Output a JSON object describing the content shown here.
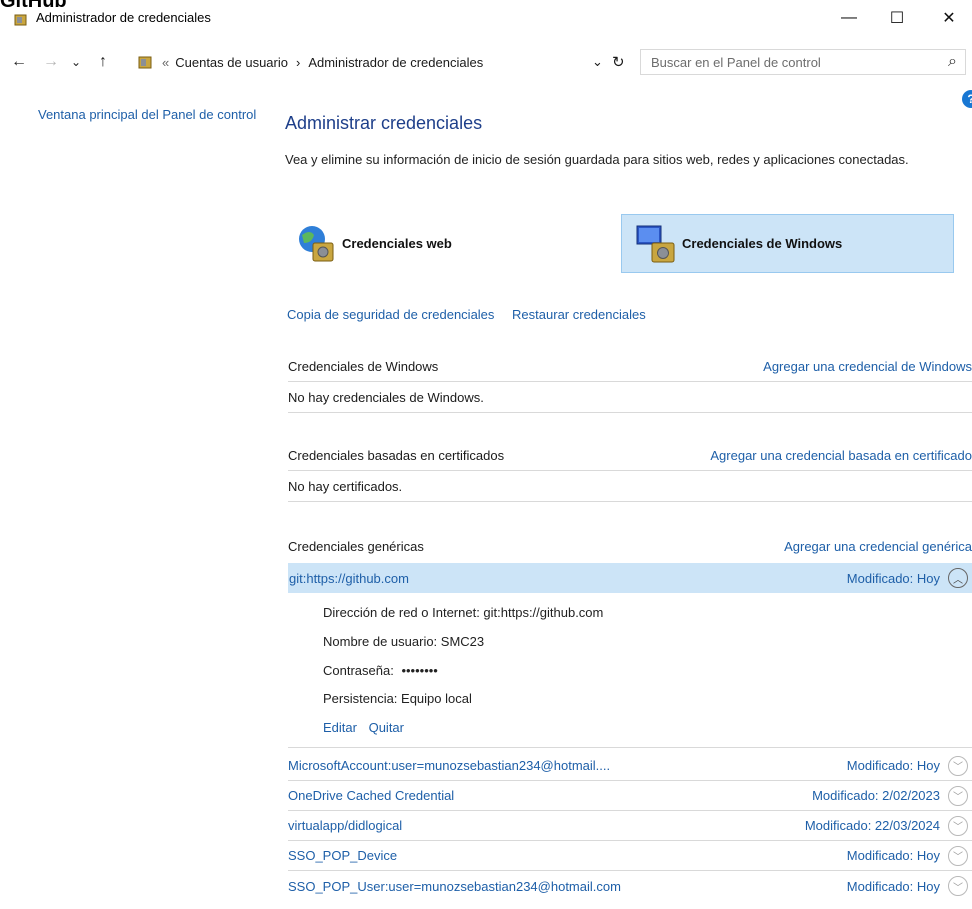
{
  "top_label": "GitHub",
  "window": {
    "title": "Administrador de credenciales",
    "minimize": "—",
    "maximize": "☐",
    "close": "✕"
  },
  "address": {
    "back": "←",
    "forward": "→",
    "recent": "⌄",
    "up": "↑",
    "prefix": "«",
    "crumb1": "Cuentas de usuario",
    "sep": "›",
    "crumb2": "Administrador de credenciales",
    "dropdown": "⌄",
    "refresh": "↻",
    "search_placeholder": "Buscar en el Panel de control",
    "search_icon": "⌕"
  },
  "sidebar": {
    "home_link": "Ventana principal del Panel de control"
  },
  "help_icon": "?",
  "main": {
    "title": "Administrar credenciales",
    "description": "Vea y elimine su información de inicio de sesión guardada para sitios web, redes y aplicaciones conectadas.",
    "tiles": {
      "web": "Credenciales web",
      "windows": "Credenciales de Windows"
    },
    "backup_link": "Copia de seguridad de credenciales",
    "restore_link": "Restaurar credenciales"
  },
  "sections": {
    "windows": {
      "title": "Credenciales de Windows",
      "add": "Agregar una credencial de Windows",
      "empty": "No hay credenciales de Windows."
    },
    "cert": {
      "title": "Credenciales basadas en certificados",
      "add": "Agregar una credencial basada en certificado",
      "empty": "No hay certificados."
    },
    "generic": {
      "title": "Credenciales genéricas",
      "add": "Agregar una credencial genérica"
    }
  },
  "expanded": {
    "name": "git:https://github.com",
    "modified": "Modificado:  Hoy",
    "address_line": "Dirección de red o Internet:  git:https://github.com",
    "user_line": "Nombre de usuario:  SMC23",
    "password_label": "Contraseña:",
    "password_value": "••••••••",
    "persistence_line": "Persistencia:  Equipo local",
    "edit": "Editar",
    "remove": "Quitar"
  },
  "credentials": [
    {
      "name": "MicrosoftAccount:user=munozsebastian234@hotmail....",
      "modified": "Modificado:  Hoy"
    },
    {
      "name": "OneDrive Cached Credential",
      "modified": "Modificado:  2/02/2023"
    },
    {
      "name": "virtualapp/didlogical",
      "modified": "Modificado:  22/03/2024"
    },
    {
      "name": "SSO_POP_Device",
      "modified": "Modificado:  Hoy"
    },
    {
      "name": "SSO_POP_User:user=munozsebastian234@hotmail.com",
      "modified": "Modificado:  Hoy"
    }
  ],
  "colors": {
    "link": "#1e5fa8",
    "selection": "#cce4f7",
    "heading": "#1e3f8a"
  }
}
